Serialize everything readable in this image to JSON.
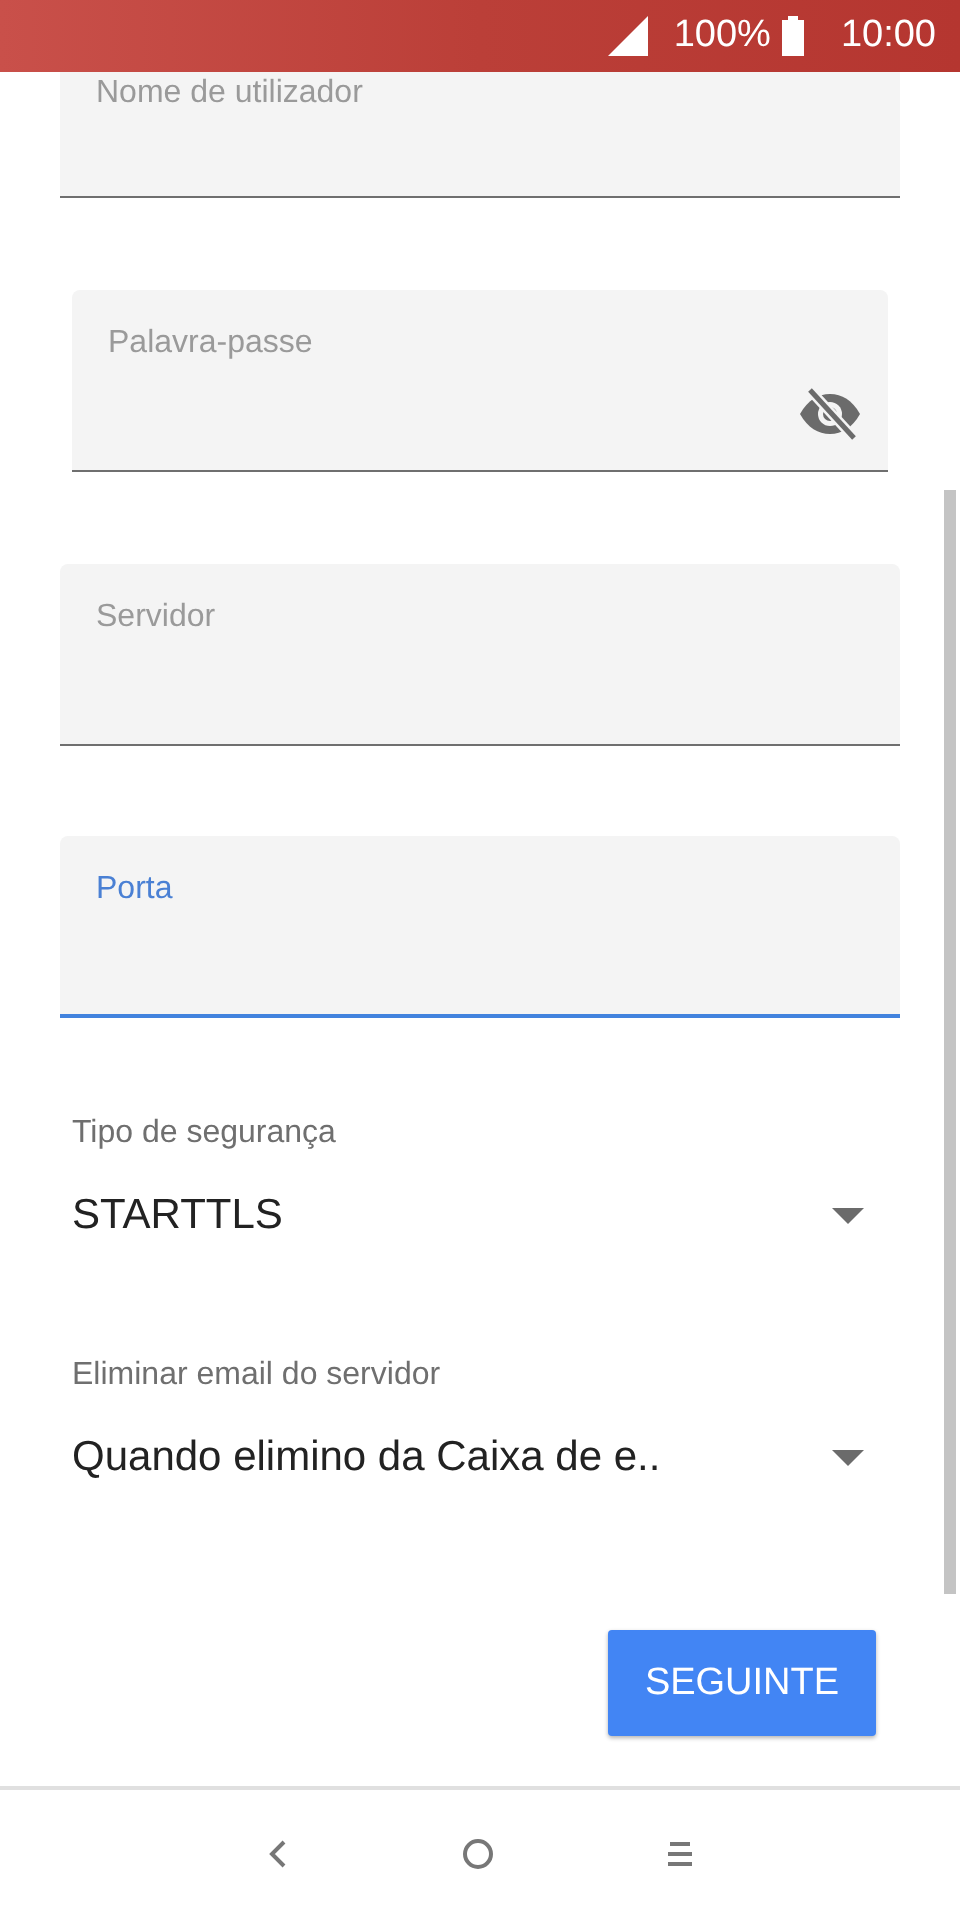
{
  "status_bar": {
    "battery": "100%",
    "time": "10:00"
  },
  "fields": [
    {
      "label": "Nome de utilizador",
      "kind": "text",
      "focused": false
    },
    {
      "label": "Palavra-passe",
      "kind": "password",
      "focused": false
    },
    {
      "label": "Servidor",
      "kind": "text",
      "focused": false
    },
    {
      "label": "Porta",
      "kind": "text",
      "focused": true
    }
  ],
  "dropdowns": [
    {
      "label": "Tipo de segurança",
      "value": "STARTTLS"
    },
    {
      "label": "Eliminar email do servidor",
      "value": "Quando elimino da Caixa de e.."
    }
  ],
  "next_button": "SEGUINTE"
}
